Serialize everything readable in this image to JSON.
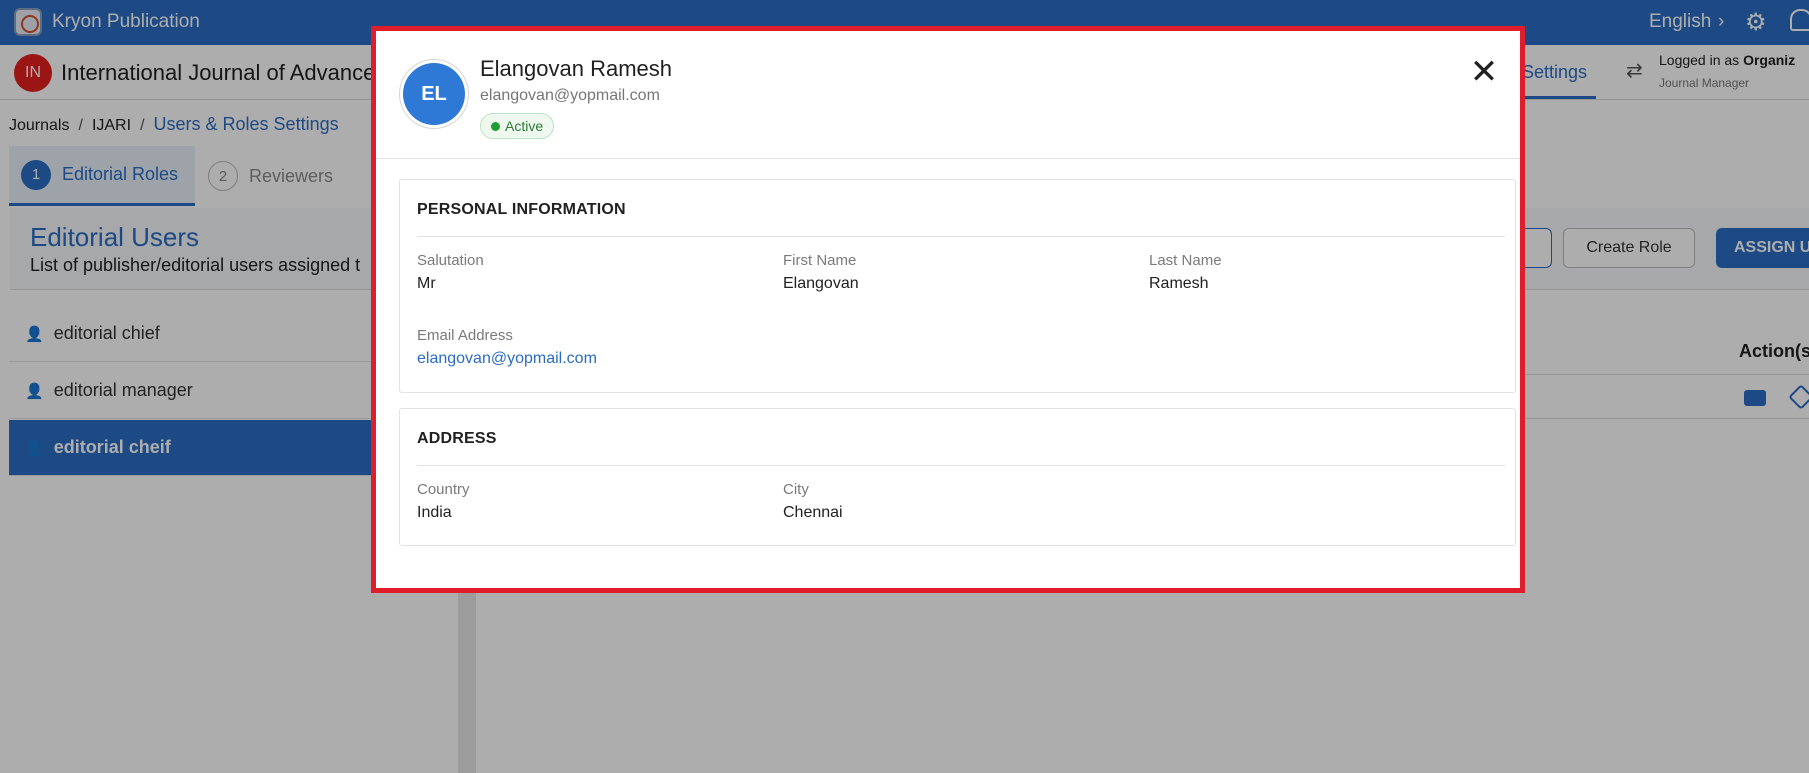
{
  "app": {
    "title": "Kryon Publication",
    "language": "English",
    "lang_chevron": "›"
  },
  "journal": {
    "badge": "IN",
    "name": "International Journal of Advance",
    "active_tab": "Settings",
    "logged_in_prefix": "Logged in as ",
    "logged_in_org": "Organiz",
    "role": "Journal Manager"
  },
  "breadcrumb": {
    "items": [
      "Journals",
      "IJARI"
    ],
    "current": "Users & Roles Settings",
    "sep": "/"
  },
  "tabs": [
    {
      "num": "1",
      "label": "Editorial Roles"
    },
    {
      "num": "2",
      "label": "Reviewers"
    }
  ],
  "users_header": {
    "title": "Editorial Users",
    "subtitle": "List of publisher/editorial users assigned t",
    "create_role": "Create Role",
    "assign_users": "ASSIGN US"
  },
  "roles": [
    "editorial chief",
    "editorial manager",
    "editorial cheif"
  ],
  "table": {
    "action_header": "Action(s)"
  },
  "modal": {
    "avatar_initials": "EL",
    "name": "Elangovan Ramesh",
    "email": "elangovan@yopmail.com",
    "status": "Active",
    "close": "✕",
    "personal": {
      "title": "PERSONAL INFORMATION",
      "salutation_label": "Salutation",
      "salutation_value": "Mr",
      "first_name_label": "First Name",
      "first_name_value": "Elangovan",
      "last_name_label": "Last Name",
      "last_name_value": "Ramesh",
      "email_label": "Email Address",
      "email_value": "elangovan@yopmail.com"
    },
    "address": {
      "title": "ADDRESS",
      "country_label": "Country",
      "country_value": "India",
      "city_label": "City",
      "city_value": "Chennai"
    }
  },
  "colors": {
    "primary": "#2b6cc4",
    "modal_border": "#e01d2b",
    "active_green": "#1f9d37",
    "badge_red": "#e62020"
  }
}
